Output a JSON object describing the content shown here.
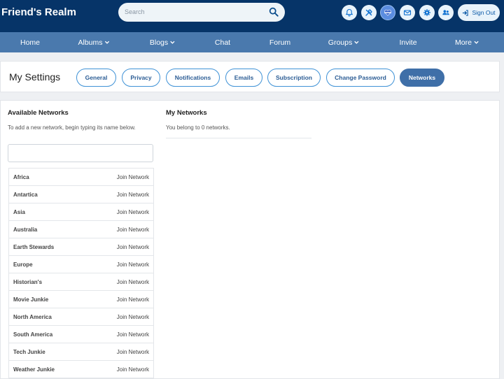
{
  "header": {
    "brand": "Friend's Realm",
    "search_placeholder": "Search",
    "signout_label": "Sign Out",
    "icons": [
      "bell-icon",
      "tools-icon",
      "avatar",
      "mail-icon",
      "gear-icon",
      "users-icon"
    ]
  },
  "nav": {
    "items": [
      {
        "label": "Home",
        "dropdown": false
      },
      {
        "label": "Albums",
        "dropdown": true
      },
      {
        "label": "Blogs",
        "dropdown": true
      },
      {
        "label": "Chat",
        "dropdown": false
      },
      {
        "label": "Forum",
        "dropdown": false
      },
      {
        "label": "Groups",
        "dropdown": true
      },
      {
        "label": "Invite",
        "dropdown": false
      },
      {
        "label": "More",
        "dropdown": true
      }
    ]
  },
  "settings": {
    "title": "My Settings",
    "tabs": [
      {
        "label": "General",
        "active": false
      },
      {
        "label": "Privacy",
        "active": false
      },
      {
        "label": "Notifications",
        "active": false
      },
      {
        "label": "Emails",
        "active": false
      },
      {
        "label": "Subscription",
        "active": false
      },
      {
        "label": "Change Password",
        "active": false
      },
      {
        "label": "Networks",
        "active": true
      }
    ]
  },
  "available": {
    "title": "Available Networks",
    "description": "To add a new network, begin typing its name below.",
    "input_value": "",
    "join_label": "Join Network",
    "networks": [
      "Africa",
      "Antartica",
      "Asia",
      "Australia",
      "Earth Stewards",
      "Europe",
      "Historian's",
      "Movie Junkie",
      "North America",
      "South America",
      "Tech Junkie",
      "Weather Junkie"
    ]
  },
  "mine": {
    "title": "My Networks",
    "description": "You belong to 0 networks."
  },
  "colors": {
    "header_bg": "#063468",
    "nav_bg": "#4a79ad",
    "accent": "#3f92d6",
    "active_tab": "#3f6fa8"
  }
}
